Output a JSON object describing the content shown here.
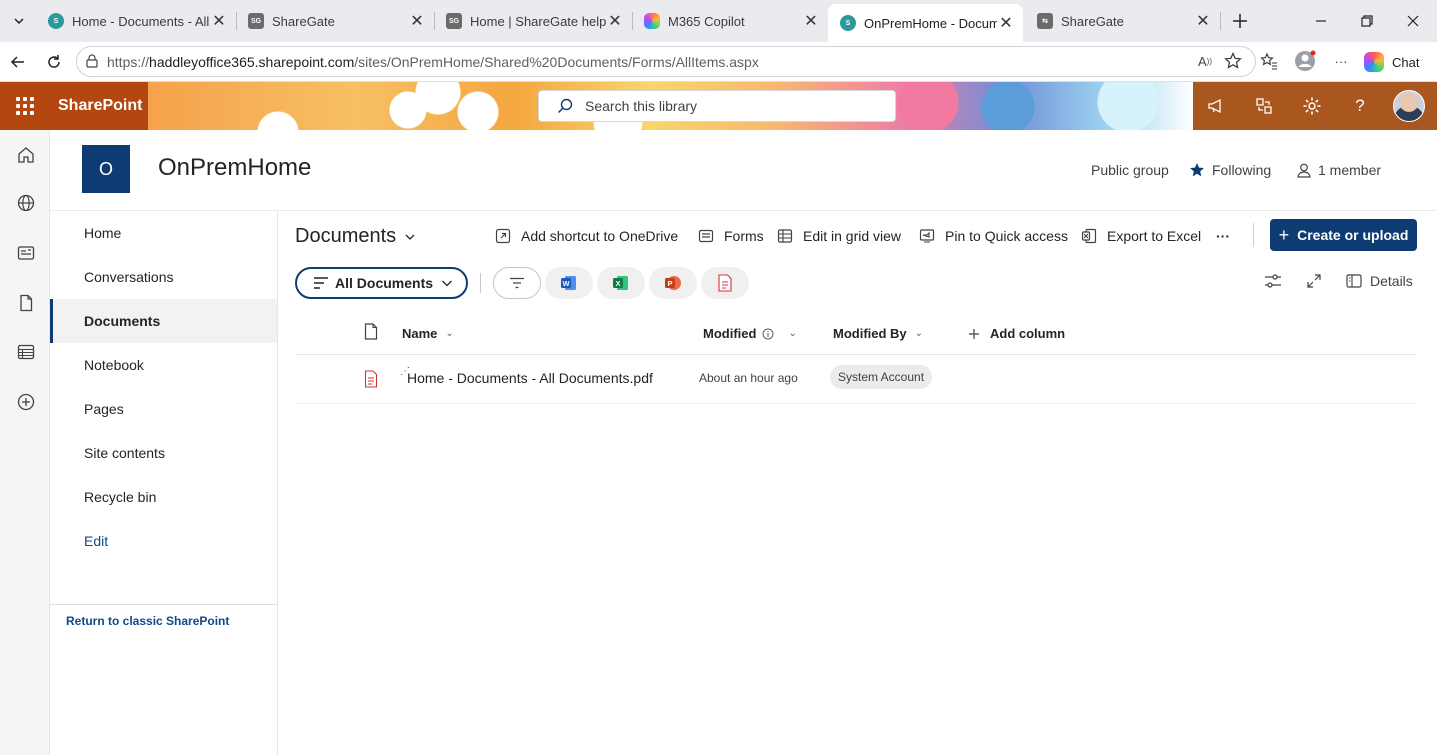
{
  "browser": {
    "tabs": [
      {
        "title": "Home - Documents - All D",
        "favicon": "sharepoint-icon",
        "color": "#2b9a9a"
      },
      {
        "title": "ShareGate",
        "favicon": "sharegate-icon",
        "color": "#5b5b5b"
      },
      {
        "title": "Home | ShareGate help",
        "favicon": "sharegate-icon",
        "color": "#5b5b5b"
      },
      {
        "title": "M365 Copilot",
        "favicon": "copilot-icon",
        "color": "#b04aff"
      },
      {
        "title": "OnPremHome - Documen",
        "favicon": "sharepoint-icon",
        "color": "#2b9a9a"
      },
      {
        "title": "ShareGate",
        "favicon": "sharegate-icon",
        "color": "#5b5b5b"
      }
    ],
    "favicon_text": "SG",
    "url_prefix": "https://",
    "url_host": "haddleyoffice365.sharepoint.com",
    "url_path": "/sites/OnPremHome/Shared%20Documents/Forms/AllItems.aspx",
    "chat_label": "Chat"
  },
  "suitebar": {
    "brand": "SharePoint",
    "search_placeholder": "Search this library"
  },
  "site": {
    "logo_letter": "O",
    "title": "OnPremHome",
    "privacy": "Public group",
    "following": "Following",
    "members": "1 member"
  },
  "leftnav": {
    "items": [
      "Home",
      "Conversations",
      "Documents",
      "Notebook",
      "Pages",
      "Site contents",
      "Recycle bin"
    ],
    "edit": "Edit",
    "classic_link": "Return to classic SharePoint"
  },
  "library": {
    "title": "Documents",
    "commands": {
      "shortcut": "Add shortcut to OneDrive",
      "forms": "Forms",
      "grid": "Edit in grid view",
      "pin": "Pin to Quick access",
      "export": "Export to Excel",
      "more": "···"
    },
    "create_button": "Create or upload",
    "view_name": "All Documents",
    "details": "Details",
    "columns": {
      "name": "Name",
      "modified": "Modified",
      "modified_by": "Modified By",
      "add_column": "Add column"
    },
    "rows": [
      {
        "name": "Home - Documents - All Documents.pdf",
        "modified": "About an hour ago",
        "modified_by": "System Account"
      }
    ]
  },
  "colors": {
    "accent": "#0f3b73",
    "suitebar": "#b4470f"
  }
}
